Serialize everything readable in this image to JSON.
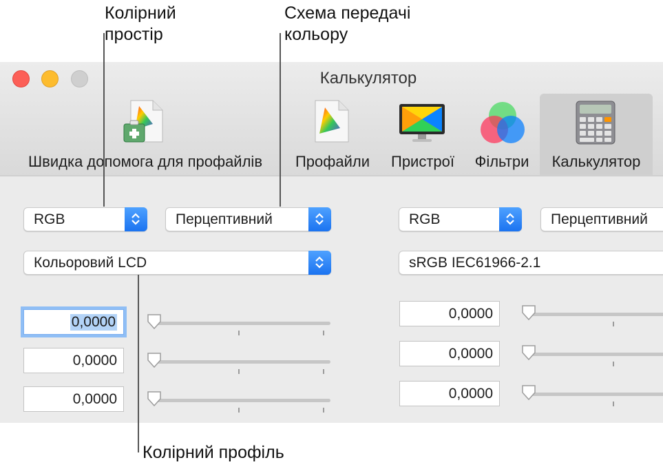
{
  "callouts": {
    "color_space": "Колірний\nпростір",
    "rendering_intent": "Схема передачі\nкольору",
    "color_profile": "Колірний профіль"
  },
  "window": {
    "title": "Калькулятор"
  },
  "toolbar": {
    "items": [
      {
        "label": "Швидка допомога для профайлів",
        "icon": "profile-first-aid-icon",
        "active": false
      },
      {
        "label": "Профайли",
        "icon": "profiles-icon",
        "active": false
      },
      {
        "label": "Пристрої",
        "icon": "devices-icon",
        "active": false
      },
      {
        "label": "Фільтри",
        "icon": "filters-icon",
        "active": false
      },
      {
        "label": "Калькулятор",
        "icon": "calculator-icon",
        "active": true
      }
    ]
  },
  "left_panel": {
    "color_space": "RGB",
    "rendering_intent": "Перцептивний",
    "profile": "Кольоровий LCD",
    "values": [
      "0,0000",
      "0,0000",
      "0,0000"
    ],
    "slider_levels": [
      0,
      0,
      0
    ]
  },
  "right_panel": {
    "color_space": "RGB",
    "rendering_intent": "Перцептивний",
    "profile": "sRGB IEC61966-2.1",
    "values": [
      "0,0000",
      "0,0000",
      "0,0000"
    ],
    "slider_levels": [
      0,
      0,
      0
    ]
  },
  "colors": {
    "accent": "#1b73f0",
    "focus_ring": "#8fbef5",
    "close": "#fc5f57",
    "minimize": "#fdbc2e",
    "zoom": "#cfcfcf"
  }
}
